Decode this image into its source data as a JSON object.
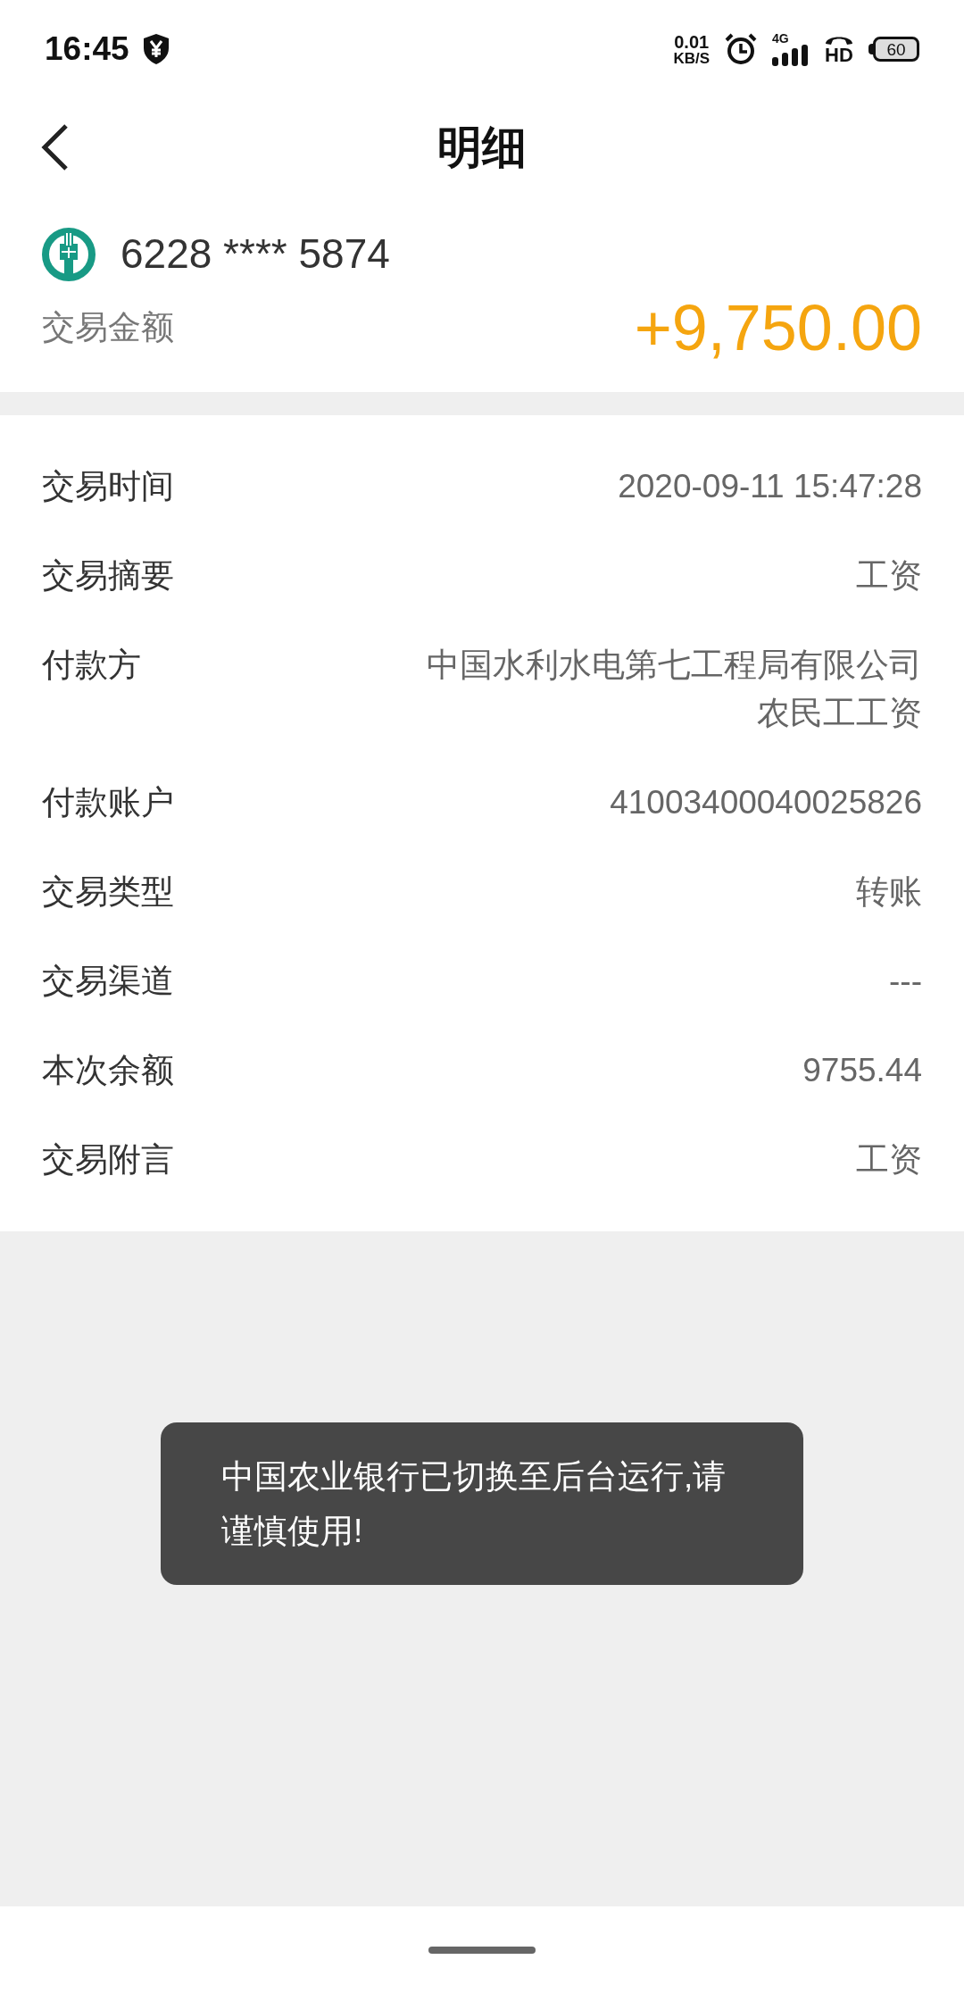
{
  "status_bar": {
    "time": "16:45",
    "net_speed": "0.01",
    "net_unit": "KB/S",
    "network": "4G",
    "hd": "HD",
    "battery": "60"
  },
  "header": {
    "title": "明细"
  },
  "account": {
    "card_number": "6228 **** 5874",
    "amount_label": "交易金额",
    "amount": "+9,750.00"
  },
  "details": [
    {
      "label": "交易时间",
      "value": "2020-09-11 15:47:28"
    },
    {
      "label": "交易摘要",
      "value": "工资"
    },
    {
      "label": "付款方",
      "value": "中国水利水电第七工程局有限公司农民工工资"
    },
    {
      "label": "付款账户",
      "value": "41003400040025826"
    },
    {
      "label": "交易类型",
      "value": "转账"
    },
    {
      "label": "交易渠道",
      "value": "---"
    },
    {
      "label": "本次余额",
      "value": "9755.44"
    },
    {
      "label": "交易附言",
      "value": "工资"
    }
  ],
  "toast": {
    "message": "中国农业银行已切换至后台运行,请谨慎使用!"
  }
}
